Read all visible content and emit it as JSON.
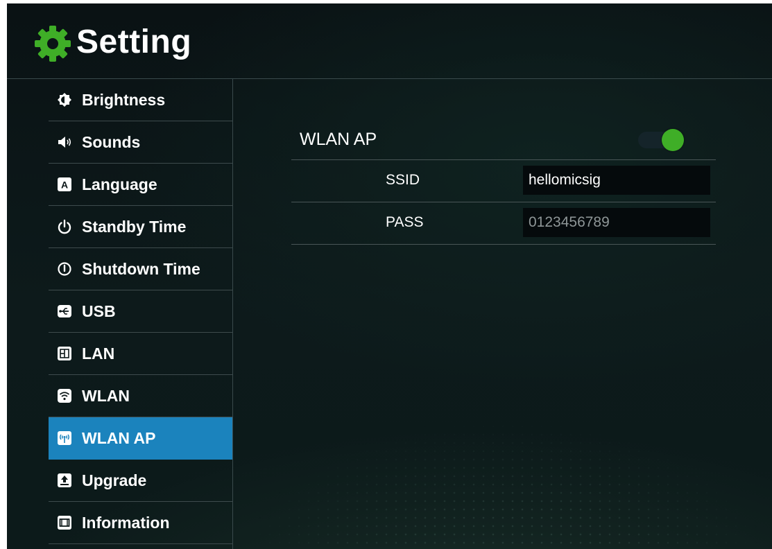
{
  "header": {
    "title": "Setting"
  },
  "sidebar": {
    "items": [
      {
        "label": "Brightness",
        "icon": "brightness-icon"
      },
      {
        "label": "Sounds",
        "icon": "speaker-icon"
      },
      {
        "label": "Language",
        "icon": "language-icon"
      },
      {
        "label": "Standby Time",
        "icon": "power-icon"
      },
      {
        "label": "Shutdown Time",
        "icon": "shutdown-icon"
      },
      {
        "label": "USB",
        "icon": "usb-icon"
      },
      {
        "label": "LAN",
        "icon": "lan-icon"
      },
      {
        "label": "WLAN",
        "icon": "wifi-icon"
      },
      {
        "label": "WLAN AP",
        "icon": "wifi-ap-icon",
        "selected": true
      },
      {
        "label": "Upgrade",
        "icon": "upgrade-icon"
      },
      {
        "label": "Information",
        "icon": "information-icon"
      }
    ]
  },
  "main": {
    "section_title": "WLAN AP",
    "toggle_on": true,
    "ssid": {
      "label": "SSID",
      "value": "hellomicsig"
    },
    "pass": {
      "label": "PASS",
      "value": "0123456789"
    }
  },
  "colors": {
    "accent_selected": "#1b83bd",
    "toggle_on": "#3fae27",
    "gear": "#3fae27",
    "background": "#0c1718"
  }
}
